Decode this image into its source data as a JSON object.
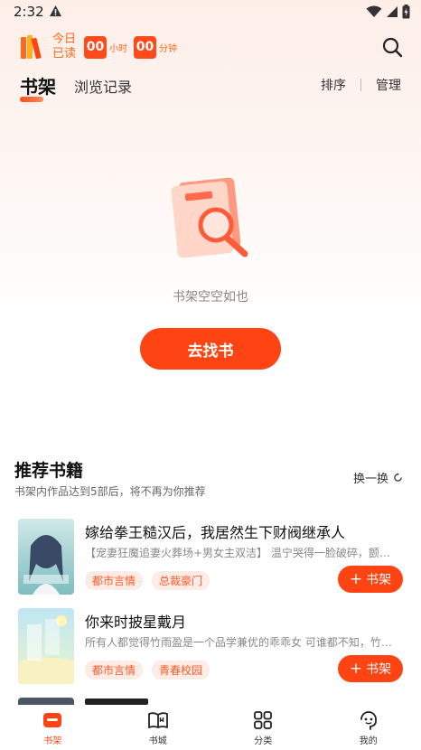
{
  "status_bar": {
    "time": "2:32"
  },
  "reading": {
    "today_label_1": "今日",
    "today_label_2": "已读",
    "hours": "00",
    "hours_unit": "小时",
    "minutes": "00",
    "minutes_unit": "分钟"
  },
  "tabs": {
    "active": "书架",
    "history": "浏览记录",
    "sort": "排序",
    "manage": "管理"
  },
  "empty": {
    "text": "书架空空如也",
    "button": "去找书"
  },
  "recommend": {
    "title": "推荐书籍",
    "subtitle": "书架内作品达到5部后，将不再为你推荐",
    "refresh": "换一换",
    "books": [
      {
        "title": "嫁给拳王糙汉后，我居然生下财阀继承人",
        "desc": "【宠妻狂魔追妻火葬场+男女主双洁】 温宁哭得一脸破碎，颤抖着",
        "tags": [
          "都市言情",
          "总裁豪门"
        ],
        "add_label": "书架"
      },
      {
        "title": "你来时披星戴月",
        "desc": "所有人都觉得竹雨盈是一个品学兼优的乖乖女 可谁都不知，竹雨盈",
        "tags": [
          "都市言情",
          "青春校园"
        ],
        "add_label": "书架"
      }
    ]
  },
  "nav": {
    "shelf": "书架",
    "store": "书城",
    "category": "分类",
    "mine": "我的"
  },
  "colors": {
    "accent": "#ff4414",
    "accent_light": "#fdebe5"
  }
}
